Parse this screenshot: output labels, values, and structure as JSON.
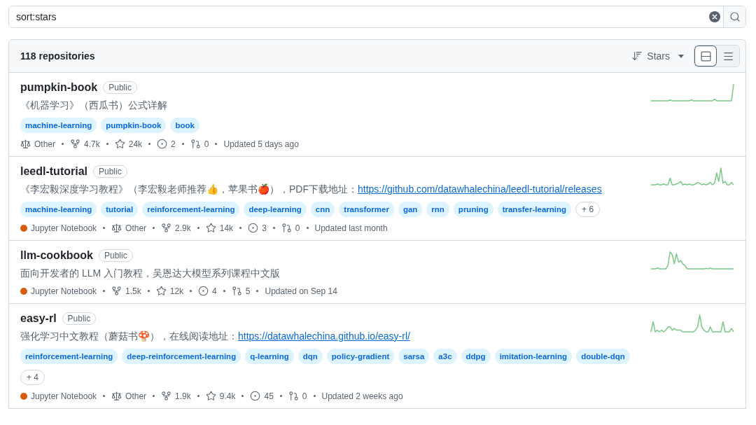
{
  "search": {
    "value": "sort:stars"
  },
  "results": {
    "count": "118 repositories",
    "sort": {
      "label": "Stars"
    },
    "views": [
      {
        "kind": "cards",
        "selected": true
      },
      {
        "kind": "list",
        "selected": false
      }
    ]
  },
  "repos": [
    {
      "name": "pumpkin-book",
      "visibility": "Public",
      "description": {
        "text": "《机器学习》（西瓜书）公式详解"
      },
      "topics": [
        "machine-learning",
        "pumpkin-book",
        "book"
      ],
      "meta": [
        {
          "kind": "license",
          "text": "Other"
        },
        {
          "kind": "forks",
          "text": "4.7k"
        },
        {
          "kind": "stars",
          "text": "24k"
        },
        {
          "kind": "issues",
          "text": "2"
        },
        {
          "kind": "prs",
          "text": "0"
        },
        {
          "kind": "updated",
          "text": "Updated 5 days ago"
        }
      ]
    },
    {
      "name": "leedl-tutorial",
      "visibility": "Public",
      "description": {
        "text": "《李宏毅深度学习教程》（李宏毅老师推荐👍，苹果书🍎），PDF下载地址：",
        "link": "https://github.com/datawhalechina/leedl-tutorial/releases"
      },
      "topics": [
        "machine-learning",
        "tutorial",
        "reinforcement-learning",
        "deep-learning",
        "cnn",
        "transformer",
        "gan",
        "rnn",
        "pruning",
        "transfer-learning"
      ],
      "more_topics": "+ 6",
      "meta": [
        {
          "kind": "language",
          "text": "Jupyter Notebook",
          "color": "#da5b0b"
        },
        {
          "kind": "license",
          "text": "Other"
        },
        {
          "kind": "forks",
          "text": "2.9k"
        },
        {
          "kind": "stars",
          "text": "14k"
        },
        {
          "kind": "issues",
          "text": "3"
        },
        {
          "kind": "prs",
          "text": "0"
        },
        {
          "kind": "updated",
          "text": "Updated last month"
        }
      ]
    },
    {
      "name": "llm-cookbook",
      "visibility": "Public",
      "description": {
        "text": "面向开发者的 LLM 入门教程，吴恩达大模型系列课程中文版"
      },
      "meta": [
        {
          "kind": "language",
          "text": "Jupyter Notebook",
          "color": "#da5b0b"
        },
        {
          "kind": "forks",
          "text": "1.5k"
        },
        {
          "kind": "stars",
          "text": "12k"
        },
        {
          "kind": "issues",
          "text": "4"
        },
        {
          "kind": "prs",
          "text": "5"
        },
        {
          "kind": "updated",
          "text": "Updated on Sep 14"
        }
      ]
    },
    {
      "name": "easy-rl",
      "visibility": "Public",
      "description": {
        "text": "强化学习中文教程（蘑菇书🍄），在线阅读地址：",
        "link": "https://datawhalechina.github.io/easy-rl/"
      },
      "topics": [
        "reinforcement-learning",
        "deep-reinforcement-learning",
        "q-learning",
        "dqn",
        "policy-gradient",
        "sarsa",
        "a3c",
        "ddpg",
        "imitation-learning",
        "double-dqn"
      ],
      "more_topics": "+ 4",
      "meta": [
        {
          "kind": "language",
          "text": "Jupyter Notebook",
          "color": "#da5b0b"
        },
        {
          "kind": "license",
          "text": "Other"
        },
        {
          "kind": "forks",
          "text": "1.9k"
        },
        {
          "kind": "stars",
          "text": "9.4k"
        },
        {
          "kind": "issues",
          "text": "45"
        },
        {
          "kind": "prs",
          "text": "0"
        },
        {
          "kind": "updated",
          "text": "Updated 2 weeks ago"
        }
      ]
    }
  ]
}
